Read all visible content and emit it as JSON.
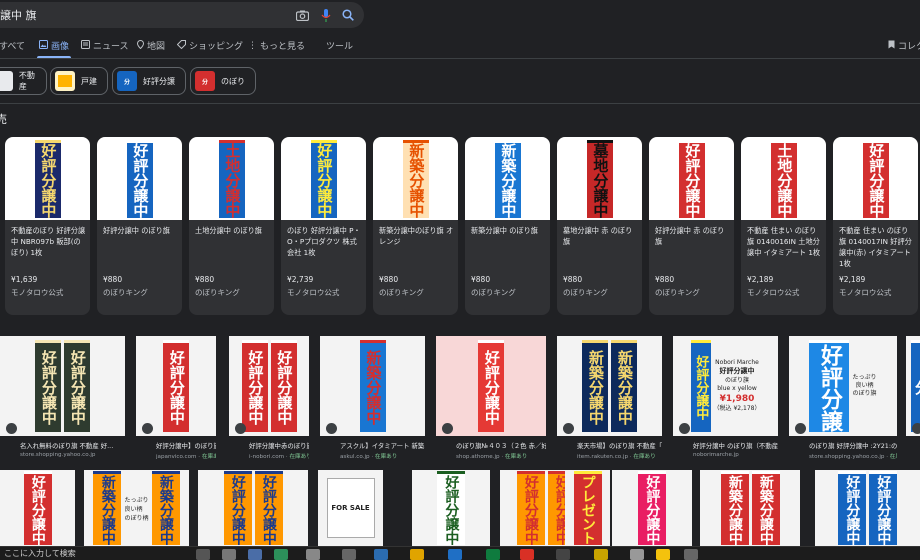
{
  "search": {
    "query": "譲中 旗"
  },
  "tabs": [
    {
      "label": "すべて",
      "icon": "search-icon"
    },
    {
      "label": "画像",
      "icon": "image-icon"
    },
    {
      "label": "ニュース",
      "icon": "news-icon"
    },
    {
      "label": "地図",
      "icon": "map-pin-icon"
    },
    {
      "label": "ショッピング",
      "icon": "tag-icon"
    },
    {
      "label": "もっと見る",
      "icon": "more-vert-icon"
    },
    {
      "label": "ツール",
      "icon": ""
    },
    {
      "label": "コレク",
      "icon": "bookmark-icon"
    }
  ],
  "chips": [
    {
      "label": "不動産",
      "thumb_text": ""
    },
    {
      "label": "戸建",
      "thumb_text": ""
    },
    {
      "label": "好評分譲",
      "thumb_text": "分"
    },
    {
      "label": "のぼり",
      "thumb_text": "分"
    }
  ],
  "section_title": "売",
  "products": [
    {
      "title": "不動産のぼり 好評分譲中 NBR097b 販部(のぼり) 1枚",
      "price": "¥1,639",
      "store": "モノタロウ公式",
      "banner_text": "好評分譲中",
      "bg": "#1b2a6b",
      "fg": "#f5d76e"
    },
    {
      "title": "好評分譲中 のぼり旗",
      "price": "¥880",
      "store": "のぼりキング",
      "banner_text": "好評分譲中",
      "bg": "#1565c0",
      "fg": "#ffffff"
    },
    {
      "title": "土地分譲中 のぼり旗",
      "price": "¥880",
      "store": "のぼりキング",
      "banner_text": "土地分譲中",
      "bg": "#1565c0",
      "fg": "#d32f2f"
    },
    {
      "title": "のぼり 好評分譲中 P・O・Pプロダクツ 株式会社 1枚",
      "price": "¥2,739",
      "store": "モノタロウ公式",
      "banner_text": "好評分譲中",
      "bg": "#1565c0",
      "fg": "#ffeb3b"
    },
    {
      "title": "新築分譲中のぼり旗 オレンジ",
      "price": "¥880",
      "store": "のぼりキング",
      "banner_text": "新築分譲中",
      "bg": "#ffe0b2",
      "fg": "#e65100"
    },
    {
      "title": "新築分譲中 のぼり旗",
      "price": "¥880",
      "store": "のぼりキング",
      "banner_text": "新築分譲中",
      "bg": "#1976d2",
      "fg": "#ffffff"
    },
    {
      "title": "墓地分譲中 赤 のぼり旗",
      "price": "¥880",
      "store": "のぼりキング",
      "banner_text": "墓地分譲中",
      "bg": "#c62828",
      "fg": "#111111"
    },
    {
      "title": "好評分譲中 赤 のぼり旗",
      "price": "¥880",
      "store": "のぼりキング",
      "banner_text": "好評分譲中",
      "bg": "#d32f2f",
      "fg": "#ffffff"
    },
    {
      "title": "不動産 住まい のぼり旗 0140016IN 土地分譲中 イタミアート 1枚",
      "price": "¥2,189",
      "store": "モノタロウ公式",
      "banner_text": "土地分譲中",
      "bg": "#d32f2f",
      "fg": "#ffffff"
    },
    {
      "title": "不動産 住まい のぼり旗 0140017IN 好評分譲中(赤) イタミアート 1枚",
      "price": "¥2,189",
      "store": "モノタロウ公式",
      "banner_text": "好評分譲中",
      "bg": "#d32f2f",
      "fg": "#ffffff"
    }
  ],
  "grid_row1": [
    {
      "caption": "名入れ無料のぼり旗 不動産 好...",
      "source": "store.shopping.yahoo.co.jp",
      "stock": "",
      "banner_text": "好評分譲中",
      "bg": "#2e3b2f",
      "fg": "#f5e6b3",
      "count": 2
    },
    {
      "caption": "好評分譲中】のぼり旗",
      "source": "japanvico.com",
      "stock": "在庫あり",
      "banner_text": "好評分譲中",
      "bg": "#d32f2f",
      "fg": "#ffffff",
      "count": 1
    },
    {
      "caption": "好評分譲中赤のぼり旗0...",
      "source": "i-nobori.com",
      "stock": "在庫あり",
      "banner_text": "好評分譲中",
      "bg": "#d32f2f",
      "fg": "#ffffff",
      "count": 2
    },
    {
      "caption": "アスクル】イタミアート 新築...",
      "source": "askul.co.jp",
      "stock": "在庫あり",
      "banner_text": "新築分譲中",
      "bg": "#1976d2",
      "fg": "#d32f2f",
      "count": 1
    },
    {
      "caption": "のぼり旗№４０３（２色 赤／好...",
      "source": "shop.athome.jp",
      "stock": "在庫あり",
      "banner_text": "好評分譲中",
      "bg": "#e53935",
      "fg": "#ffffff",
      "count": 1
    },
    {
      "caption": "楽天市場】のぼり旗 不動産「...",
      "source": "item.rakuten.co.jp",
      "stock": "在庫あり",
      "banner_text": "新築分譲中",
      "bg": "#0d2a5c",
      "fg": "#f5d76e",
      "count": 2
    },
    {
      "caption": "好評分譲中 のぼり旗（不動産...",
      "source": "noborimarche.jp",
      "stock": "",
      "banner_text": "好評分譲中",
      "bg": "#1565c0",
      "fg": "#ffeb3b",
      "count": 1
    },
    {
      "caption": "のぼり旗 好評分譲中 :2Y21:のぼ...",
      "source": "store.shopping.yahoo.co.jp",
      "stock": "在庫...",
      "banner_text": "好評分譲",
      "bg": "#1e88e5",
      "fg": "#ffffff",
      "count": 1
    },
    {
      "caption": "アス...",
      "source": "askul.c...",
      "stock": "",
      "banner_text": "分",
      "bg": "#1565c0",
      "fg": "#ffffff",
      "count": 1
    }
  ],
  "grid_row1_extra": {
    "nobori_marche": "Nobori Marche",
    "nobori_main": "好評分譲中",
    "nobori_sub": "のぼり旗",
    "nobori_color": "blue x yellow",
    "nobori_price": "¥1,980",
    "nobori_tax": "（税込 ¥2,178）",
    "tappuri": "たっぷり",
    "yoi_gara": "良い柄",
    "nobori_hata": "のぼり旗"
  },
  "grid_row2": [
    {
      "banner_text": "好評分譲中",
      "bg": "#d32f2f",
      "fg": "#ffffff"
    },
    {
      "banner_text": "新築分譲中",
      "bg": "#ff9800",
      "fg": "#1b3a8c"
    },
    {
      "banner_text": "好評分譲中",
      "bg": "#ff9800",
      "fg": "#1b3a8c"
    },
    {
      "banner_text": "FOR SALE",
      "bg": "#f5f5f5",
      "fg": "#222222"
    },
    {
      "banner_text": "好評分譲中",
      "bg": "#ffffff",
      "fg": "#1b5e20"
    },
    {
      "banner_text": "好評分譲中",
      "bg": "#ff9800",
      "fg": "#d32f2f"
    },
    {
      "banner_text": "プレゼント",
      "bg": "#d32f2f",
      "fg": "#ffeb3b"
    },
    {
      "banner_text": "好評分譲中",
      "bg": "#e91e63",
      "fg": "#ffffff"
    },
    {
      "banner_text": "新築分譲中",
      "bg": "#d32f2f",
      "fg": "#ffffff"
    },
    {
      "banner_text": "好評分譲中",
      "bg": "#1565c0",
      "fg": "#ffffff"
    }
  ],
  "row2_text": {
    "tappuri": "たっぷり",
    "yoi_gara": "良い柄",
    "nobori": "のぼり柄",
    "fundousan_guide": "お気軽にご相談",
    "for_sale": "FOR SALE"
  },
  "taskbar": {
    "search_placeholder": "ここに入力して検索"
  }
}
